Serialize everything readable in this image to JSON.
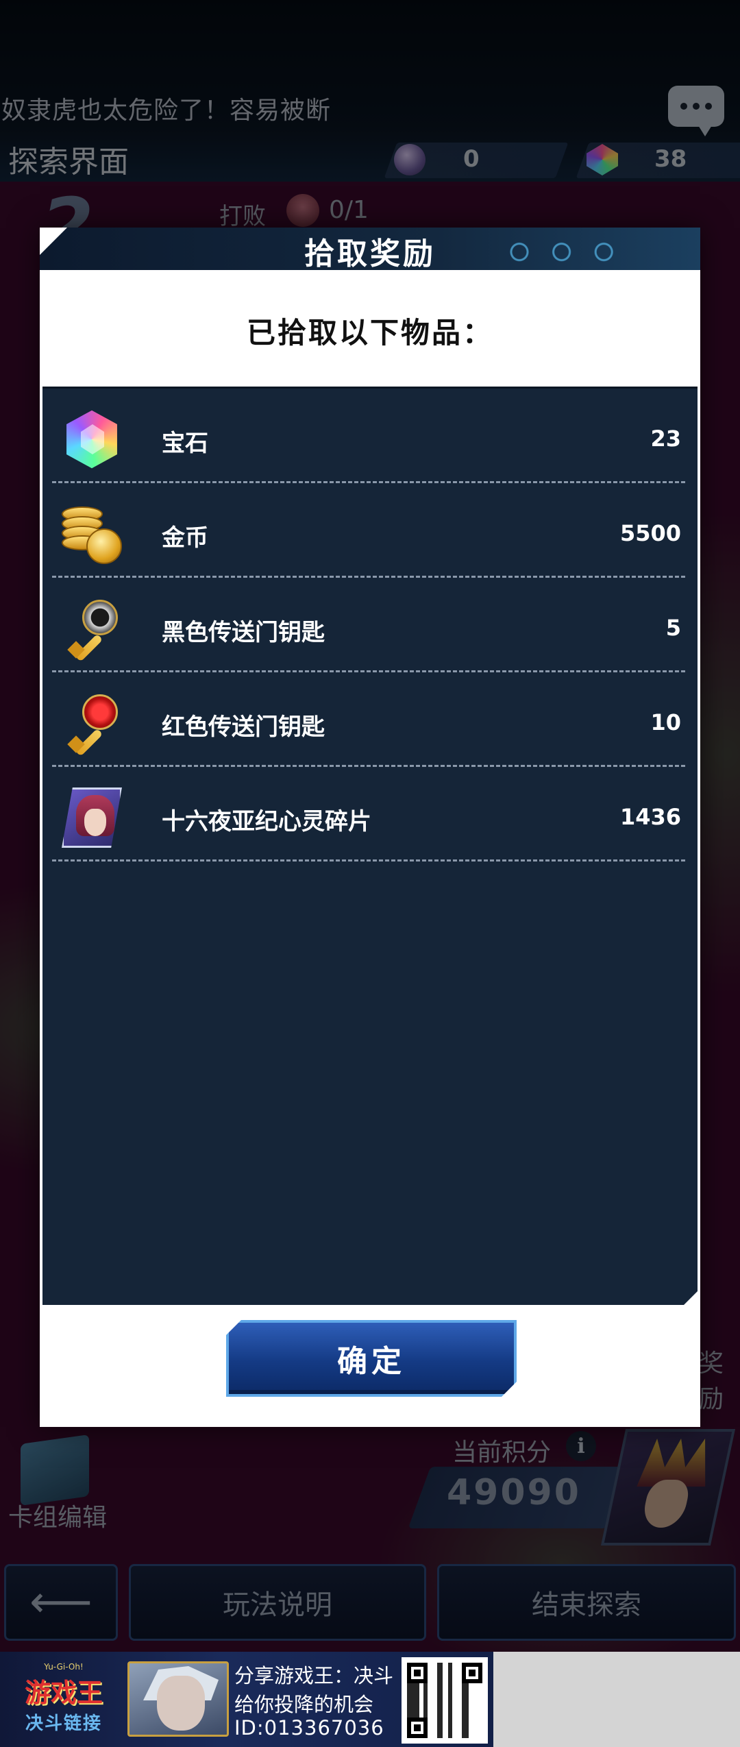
{
  "background": {
    "tip_text": "奴隶虎也太危险了！容易被断",
    "page_title": "探索界面",
    "currency": [
      {
        "icon": "orb-icon",
        "value": "0"
      },
      {
        "icon": "gem-icon",
        "value": "38"
      }
    ],
    "stage_number": "2",
    "defeat_label": "打败",
    "defeat_count": "0/1",
    "side_label": "奖励",
    "deck_edit_label": "卡组编辑",
    "score_label": "当前积分",
    "score_value": "49090",
    "nav": {
      "back_icon": "arrow-left-icon",
      "rules_label": "玩法说明",
      "end_label": "结束探索"
    }
  },
  "modal": {
    "title": "拾取奖励",
    "subtitle": "已拾取以下物品：",
    "items": [
      {
        "name": "宝石",
        "count": "23",
        "icon": "gem-icon"
      },
      {
        "name": "金币",
        "count": "5500",
        "icon": "gold-coins-icon"
      },
      {
        "name": "黑色传送门钥匙",
        "count": "5",
        "icon": "black-key-icon"
      },
      {
        "name": "红色传送门钥匙",
        "count": "10",
        "icon": "red-key-icon"
      },
      {
        "name": "十六夜亚纪心灵碎片",
        "count": "1436",
        "icon": "character-card-icon"
      }
    ],
    "confirm_label": "确定"
  },
  "ad": {
    "logo_top": "Yu-Gi-Oh!",
    "logo_main": "游戏王",
    "logo_sub": "决斗链接",
    "line1": "分享游戏王：决斗",
    "line2": "给你投降的机会",
    "line3": "ID:013367036"
  },
  "colors": {
    "panel": "#152538",
    "header": "#0c1a2e",
    "button": "#143a84",
    "accent": "#5fa8e8"
  }
}
